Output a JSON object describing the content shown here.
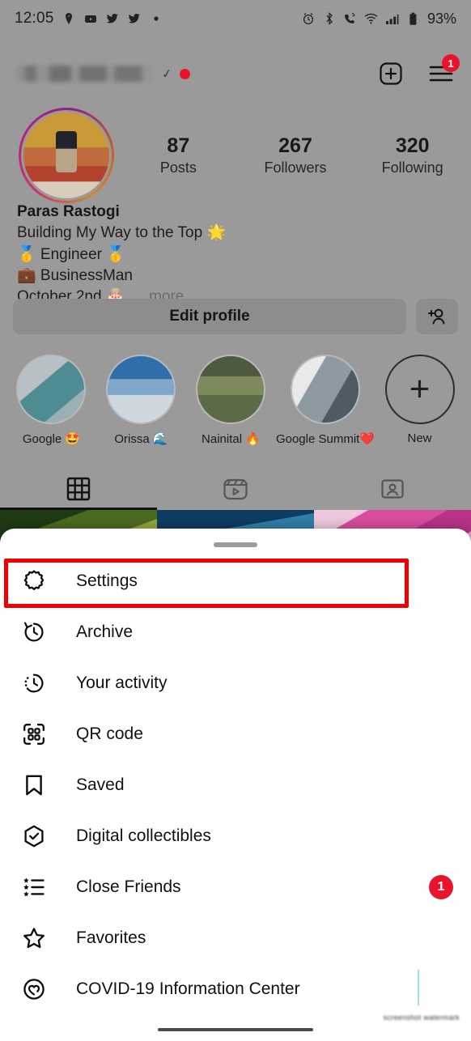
{
  "status_bar": {
    "time": "12:05",
    "battery": "93%",
    "left_icons": [
      "location-icon",
      "youtube-icon",
      "twitter-icon",
      "twitter-icon",
      "dot-icon"
    ],
    "right_icons": [
      "alarm-icon",
      "bluetooth-icon",
      "call-mute-icon",
      "wifi-icon",
      "signal-icon",
      "battery-icon"
    ]
  },
  "profile": {
    "username": "",
    "username_blurred": true,
    "verified_tick": "✓",
    "has_unread_dot": true,
    "header_actions": {
      "add_label": "+",
      "menu_badge": "1"
    },
    "stats": [
      {
        "value": "87",
        "label": "Posts"
      },
      {
        "value": "267",
        "label": "Followers"
      },
      {
        "value": "320",
        "label": "Following"
      }
    ],
    "bio": {
      "name": "Paras Rastogi",
      "lines": [
        "Building My Way to the Top 🌟",
        "🥇 Engineer 🥇",
        "💼 BusinessMan"
      ],
      "last_line": "October 2nd 🎂",
      "more_label": "… more"
    },
    "buttons": {
      "edit_profile": "Edit profile",
      "add_person": "add-person-icon"
    },
    "highlights": [
      {
        "label": "Google 🤩"
      },
      {
        "label": "Orissa 🌊"
      },
      {
        "label": "Nainital 🔥"
      },
      {
        "label": "Google Summit❤️"
      },
      {
        "label": "New"
      }
    ],
    "tabs": [
      {
        "name": "grid",
        "active": true
      },
      {
        "name": "reels",
        "active": false
      },
      {
        "name": "tagged",
        "active": false
      }
    ]
  },
  "sheet": {
    "items": [
      {
        "label": "Settings",
        "icon": "gear-icon",
        "badge": "",
        "highlighted": true
      },
      {
        "label": "Archive",
        "icon": "archive-clock-icon",
        "badge": "",
        "highlighted": false
      },
      {
        "label": "Your activity",
        "icon": "activity-clock-icon",
        "badge": "",
        "highlighted": false
      },
      {
        "label": "QR code",
        "icon": "qr-code-icon",
        "badge": "",
        "highlighted": false
      },
      {
        "label": "Saved",
        "icon": "bookmark-icon",
        "badge": "",
        "highlighted": false
      },
      {
        "label": "Digital collectibles",
        "icon": "shield-check-icon",
        "badge": "",
        "highlighted": false
      },
      {
        "label": "Close Friends",
        "icon": "star-list-icon",
        "badge": "1",
        "highlighted": false
      },
      {
        "label": "Favorites",
        "icon": "star-icon",
        "badge": "",
        "highlighted": false
      },
      {
        "label": "COVID-19 Information Center",
        "icon": "heart-circle-icon",
        "badge": "",
        "highlighted": false
      }
    ]
  },
  "annotation": {
    "highlight_color": "#f10000",
    "target_label": "Settings"
  },
  "watermark": {
    "text": "screenshot watermark"
  },
  "colors": {
    "accent_red": "#e8142c",
    "highlight_red": "#f10000",
    "sheet_bg": "#ffffff",
    "dim_bg": "#9a9a9a"
  }
}
